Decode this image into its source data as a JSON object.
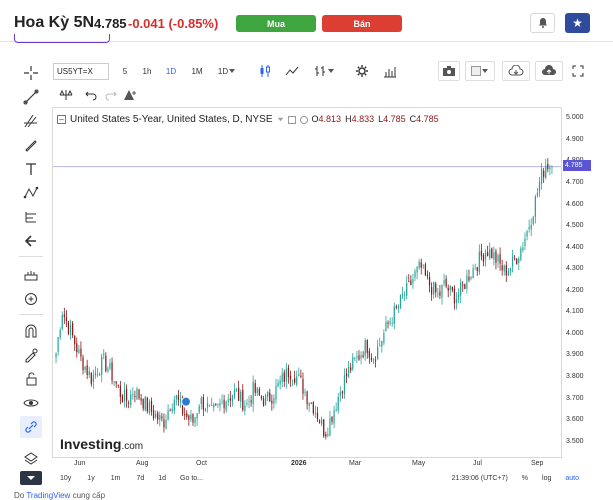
{
  "header": {
    "title": "Hoa Kỳ 5N",
    "price": "4.785",
    "change": "-0.041 (-0.85%)",
    "buy_label": "Mua",
    "sell_label": "Bán"
  },
  "toolbar": {
    "symbol": "US5YT=X",
    "intervals": [
      "5",
      "1h",
      "1D",
      "1M",
      "1D"
    ]
  },
  "legend": {
    "name": "United States 5-Year, United States, D, NYSE",
    "o_label": "O",
    "o_value": "4.813",
    "h_label": "H",
    "h_value": "4.833",
    "l_label": "L",
    "l_value": "4.785",
    "c_label": "C",
    "c_value": "4.785"
  },
  "price_axis": {
    "ticks": [
      "5.000",
      "4.900",
      "4.800",
      "4.700",
      "4.600",
      "4.500",
      "4.400",
      "4.300",
      "4.200",
      "4.100",
      "4.000",
      "3.900",
      "3.800",
      "3.700",
      "3.600",
      "3.500"
    ],
    "last_price_label": "4.785"
  },
  "date_axis": {
    "ticks": [
      "Jun",
      "Aug",
      "Oct",
      "2026",
      "Mar",
      "May",
      "Jul",
      "Sep"
    ]
  },
  "range_bar": {
    "ranges": [
      "10y",
      "1y",
      "1m",
      "7d",
      "1d",
      "Go to..."
    ],
    "time": "21:39:06 (UTC+7)",
    "pct": "%",
    "log": "log",
    "auto": "auto"
  },
  "logo": {
    "main": "Investing",
    "suffix": ".com"
  },
  "footer": {
    "prefix": "Do ",
    "link": "TradingView",
    "suffix": " cung cấp"
  },
  "colors": {
    "up": "#26a69a",
    "down": "#8b1a1a",
    "sell": "#dc3e34",
    "buy": "#3fa63f",
    "accent": "#2e4b9c"
  },
  "chart_data": {
    "type": "candlestick",
    "series": [
      {
        "name": "United States 5-Year",
        "values": [
          3.92,
          4.12,
          4.05,
          3.98,
          3.9,
          3.85,
          3.8,
          3.85,
          3.88,
          3.84,
          3.78,
          3.72,
          3.7,
          3.75,
          3.72,
          3.68,
          3.65,
          3.62,
          3.6,
          3.68,
          3.72,
          3.66,
          3.62,
          3.6,
          3.7,
          3.68,
          3.64,
          3.66,
          3.7,
          3.72,
          3.74,
          3.7,
          3.68,
          3.75,
          3.72,
          3.7,
          3.72,
          3.76,
          3.8,
          3.84,
          3.82,
          3.78,
          3.72,
          3.68,
          3.62,
          3.55,
          3.62,
          3.7,
          3.78,
          3.84,
          3.88,
          3.92,
          3.96,
          3.9,
          3.95,
          4.02,
          4.08,
          4.12,
          4.18,
          4.22,
          4.28,
          4.32,
          4.26,
          4.22,
          4.18,
          4.24,
          4.2,
          4.18,
          4.22,
          4.28,
          4.32,
          4.36,
          4.4,
          4.38,
          4.34,
          4.3,
          4.32,
          4.36,
          4.42,
          4.5,
          4.6,
          4.72,
          4.8,
          4.785
        ]
      }
    ],
    "ylim": [
      3.48,
      5.02
    ],
    "x_labels": [
      "Jun",
      "Aug",
      "Oct",
      "2026",
      "Mar",
      "May",
      "Jul",
      "Sep"
    ]
  }
}
